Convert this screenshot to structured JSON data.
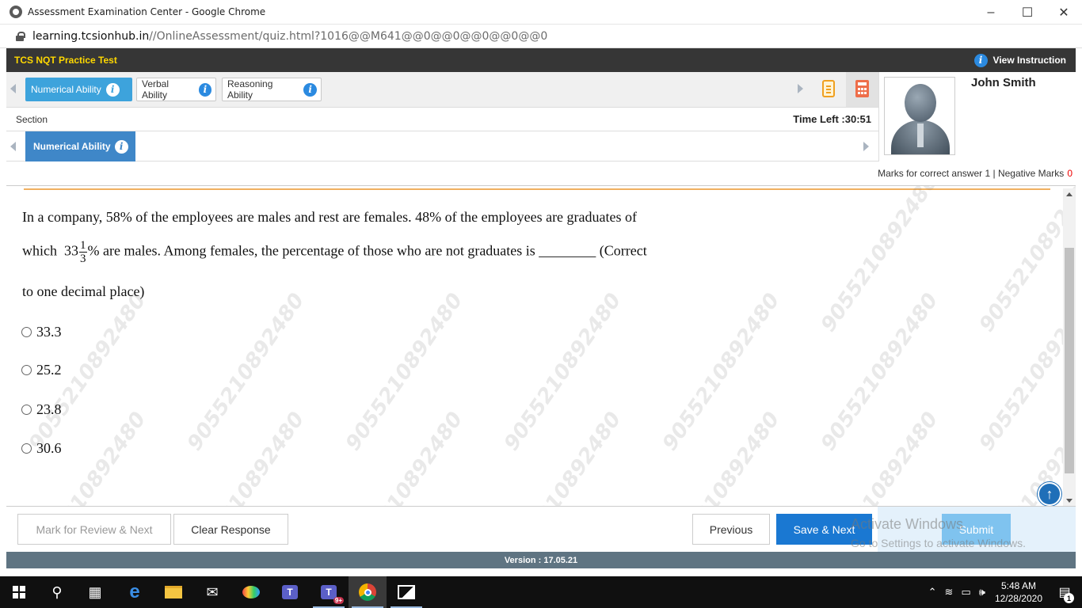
{
  "browser": {
    "window_title": "Assessment Examination Center - Google Chrome",
    "url_host": "learning.tcsionhub.in",
    "url_path": "//OnlineAssessment/quiz.html?1016@@M641@@0@@0@@0@@0@@0"
  },
  "header": {
    "test_name": "TCS NQT Practice Test",
    "view_instruction": "View Instruction",
    "info_glyph": "i"
  },
  "tabs": [
    {
      "label": "Numerical Ability",
      "active": true
    },
    {
      "label": "Verbal Ability",
      "active": false
    },
    {
      "label": "Reasoning Ability",
      "active": false
    }
  ],
  "profile": {
    "name": "John Smith"
  },
  "section": {
    "label": "Section",
    "time_left": "Time Left :30:51",
    "current": "Numerical Ability"
  },
  "marks": {
    "correct_label": "Marks for correct answer",
    "correct_value": "1",
    "separator": " | ",
    "negative_label": "Negative Marks",
    "negative_value": "0"
  },
  "question": {
    "line1": "In a company, 58% of the employees are males and rest are females. 48% of the employees are graduates of",
    "line2_before": "which  33",
    "fraction_num": "1",
    "fraction_den": "3",
    "line2_after": "% are males. Among females, the percentage of those who are not graduates is ________ (Correct",
    "line3": "to one decimal place)"
  },
  "options": [
    "33.3",
    "25.2",
    "23.8",
    "30.6"
  ],
  "watermark": "9055210892480",
  "buttons": {
    "mark_review": "Mark for Review & Next",
    "clear": "Clear Response",
    "previous": "Previous",
    "save_next": "Save & Next",
    "submit": "Submit"
  },
  "windows_activation": {
    "title": "Activate Windows",
    "subtitle": "Go to Settings to activate Windows."
  },
  "version": "Version : 17.05.21",
  "taskbar": {
    "time": "5:48 AM",
    "date": "12/28/2020",
    "teams_badge": "9+",
    "notification_count": "1"
  }
}
